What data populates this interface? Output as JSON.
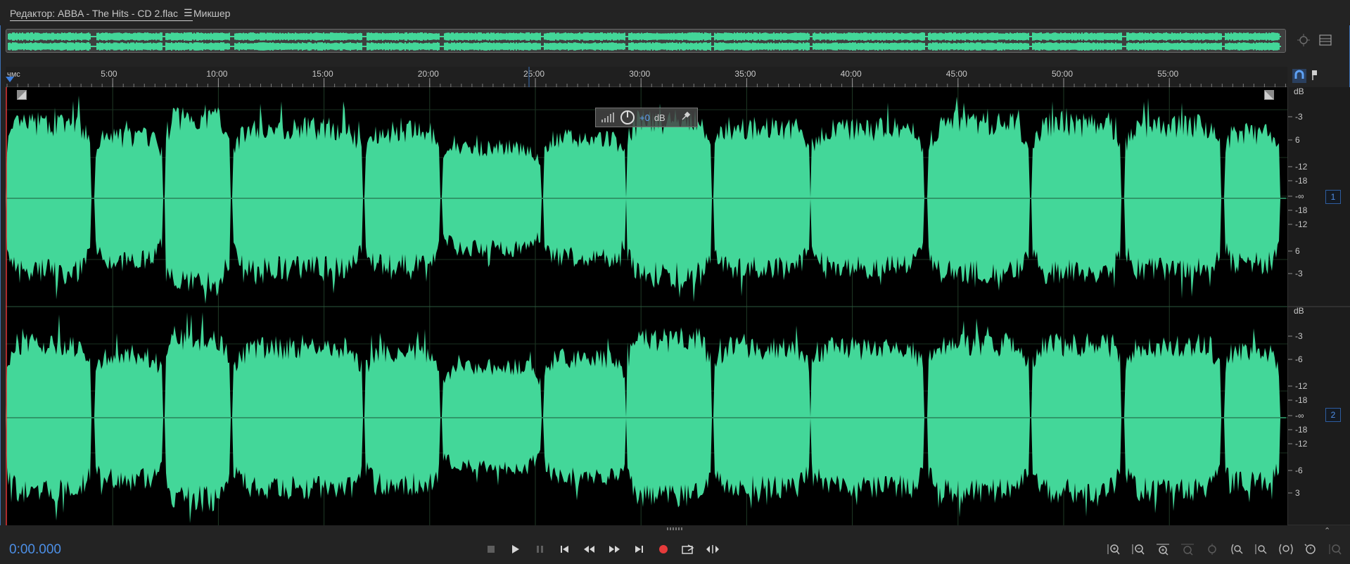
{
  "tabs": [
    {
      "label": "Редактор: ABBA - The Hits - CD 2.flac",
      "active": true
    },
    {
      "label": "Микшер",
      "active": false
    }
  ],
  "ruler": {
    "unit": "чмс",
    "ticks": [
      "5:00",
      "10:00",
      "15:00",
      "20:00",
      "25:00",
      "30:00",
      "35:00",
      "40:00",
      "45:00",
      "50:00",
      "55:00"
    ]
  },
  "hud": {
    "value": "+0",
    "unit": "dB"
  },
  "channels": [
    {
      "badge": "1",
      "unit_label": "dB",
      "scale": [
        "-3",
        "6",
        "-12",
        "-18",
        "-∞",
        "-18",
        "-12",
        "6",
        "-3"
      ]
    },
    {
      "badge": "2",
      "unit_label": "dB",
      "scale": [
        "-3",
        "-6",
        "-12",
        "-18",
        "-∞",
        "-18",
        "-12",
        "-6",
        "3"
      ]
    }
  ],
  "timecode": "0:00.000",
  "colors": {
    "waveform": "#43d799",
    "accent": "#4c8fe6",
    "record": "#e53b3b",
    "background": "#000000"
  },
  "transport": [
    "stop-icon",
    "play-icon",
    "pause-icon",
    "go-to-start-icon",
    "rewind-icon",
    "fast-forward-icon",
    "go-to-end-icon",
    "record-icon",
    "loop-playback-icon",
    "skip-selection-icon"
  ],
  "zoom_tools": [
    "zoom-in-amplitude-icon",
    "zoom-out-amplitude-icon",
    "zoom-in-time-icon",
    "zoom-out-full-time-icon",
    "zoom-to-selection-icon",
    "zoom-in-left-icon",
    "zoom-out-left-icon",
    "zoom-in-right-icon",
    "zoom-full-icon",
    "zoom-reset-icon",
    "zoom-tool-icon"
  ]
}
